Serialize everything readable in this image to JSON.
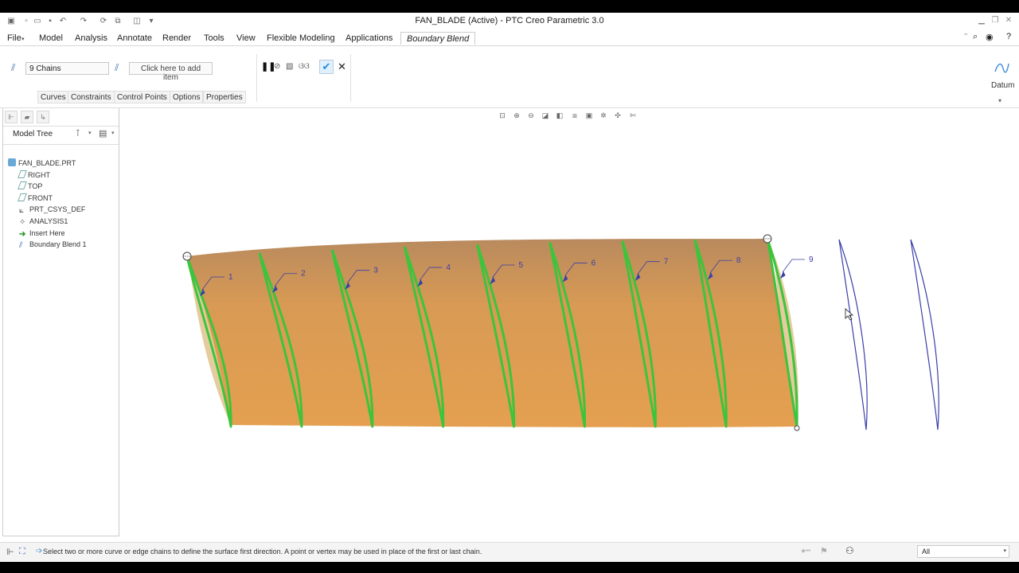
{
  "window": {
    "title": "FAN_BLADE (Active) - PTC Creo Parametric 3.0"
  },
  "menu": {
    "tabs": [
      "File",
      "Model",
      "Analysis",
      "Annotate",
      "Render",
      "Tools",
      "View",
      "Flexible Modeling",
      "Applications",
      "Boundary Blend"
    ],
    "active_tab": "Boundary Blend"
  },
  "ribbon": {
    "chains_value": "9 Chains",
    "add_item_label": "Click here to add item",
    "datum_label": "Datum",
    "tabs": [
      "Curves",
      "Constraints",
      "Control Points",
      "Options",
      "Properties"
    ]
  },
  "model_tree": {
    "title": "Model Tree",
    "items": [
      {
        "label": "FAN_BLADE.PRT",
        "icon": "part-icon"
      },
      {
        "label": "RIGHT",
        "icon": "datum-plane-icon"
      },
      {
        "label": "TOP",
        "icon": "datum-plane-icon"
      },
      {
        "label": "FRONT",
        "icon": "datum-plane-icon"
      },
      {
        "label": "PRT_CSYS_DEF",
        "icon": "csys-icon"
      },
      {
        "label": "ANALYSIS1",
        "icon": "analysis-icon"
      },
      {
        "label": "Insert Here",
        "icon": "insert-arrow-icon"
      },
      {
        "label": "Boundary Blend 1",
        "icon": "boundary-blend-icon"
      }
    ]
  },
  "viewport": {
    "chain_labels": [
      "1",
      "2",
      "3",
      "4",
      "5",
      "6",
      "7",
      "8",
      "9"
    ],
    "surface_color": "#d89a54",
    "chain_color": "#3cc43c",
    "curve_color": "#3b3fa8"
  },
  "status": {
    "message": "Select two or more curve or edge chains to define the surface first direction. A point or vertex may be used in place of the first or last chain.",
    "filter_value": "All"
  }
}
